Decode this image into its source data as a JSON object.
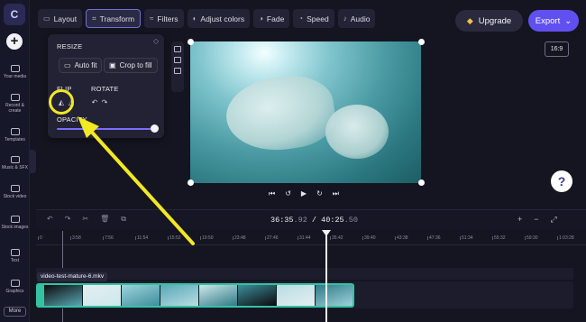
{
  "sidebar": {
    "logo": "C",
    "add_label": "+",
    "items": [
      {
        "label": "Your media",
        "icon": "folder-icon"
      },
      {
        "label": "Record & create",
        "icon": "record-icon"
      },
      {
        "label": "Templates",
        "icon": "templates-icon"
      },
      {
        "label": "Music & SFX",
        "icon": "music-icon"
      },
      {
        "label": "Stock video",
        "icon": "stock-video-icon"
      },
      {
        "label": "Stock images",
        "icon": "stock-images-icon"
      },
      {
        "label": "Text",
        "icon": "text-icon"
      },
      {
        "label": "Graphics",
        "icon": "graphics-icon"
      }
    ],
    "more_label": "More"
  },
  "toolbar": {
    "tabs": [
      {
        "label": "Layout",
        "icon": "▭"
      },
      {
        "label": "Transform",
        "icon": "⌗"
      },
      {
        "label": "Filters",
        "icon": "≈"
      },
      {
        "label": "Adjust colors",
        "icon": "◐"
      },
      {
        "label": "Fade",
        "icon": "◑"
      },
      {
        "label": "Speed",
        "icon": "◔"
      },
      {
        "label": "Audio",
        "icon": "♪"
      }
    ],
    "active_tab": "Transform",
    "upgrade_label": "Upgrade",
    "export_label": "Export",
    "export_caret": "⌄"
  },
  "aspect_ratio": "16:9",
  "transform_panel": {
    "resize_heading": "RESIZE",
    "auto_fit_label": "Auto fit",
    "crop_to_fill_label": "Crop to fill",
    "flip_heading": "FLIP",
    "rotate_heading": "ROTATE",
    "opacity_heading": "OPACITY",
    "opacity_value": 1.0
  },
  "player": {
    "help_label": "?"
  },
  "timeline": {
    "current_time": "36:35",
    "current_frac": ".92",
    "separator": " / ",
    "total_time": "40:25",
    "total_frac": ".50",
    "ruler_ticks": [
      "0",
      "3:58",
      "7:56",
      "11:54",
      "15:52",
      "19:50",
      "23:48",
      "27:46",
      "31:44",
      "35:42",
      "39:40",
      "43:38",
      "47:36",
      "51:34",
      "55:32",
      "59:30",
      "1:03:28",
      "1:07:2"
    ],
    "clip_name": "video-test-mature-6.mkv",
    "clip_frames": 8,
    "accent": "#33c3a3"
  },
  "colors": {
    "brand": "#6150f0",
    "annotation": "#f2e823"
  }
}
